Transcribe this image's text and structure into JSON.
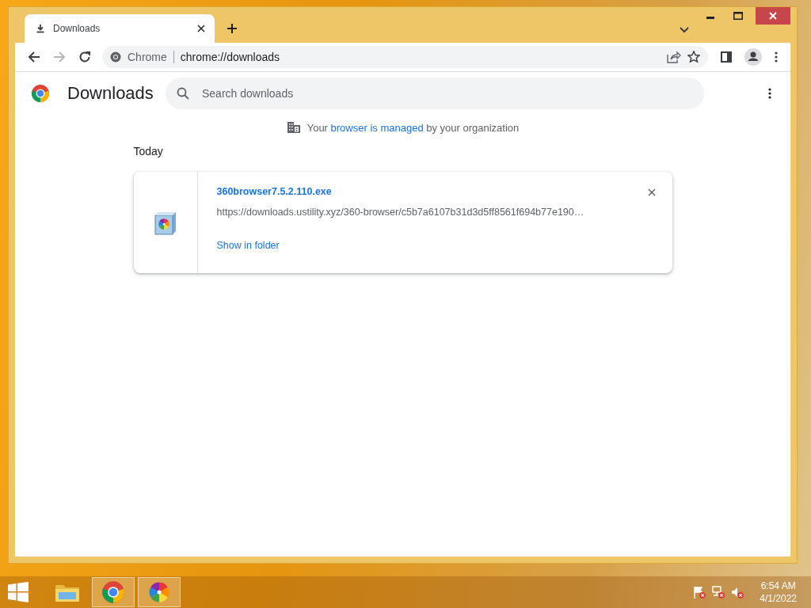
{
  "tabs": [
    {
      "title": "Downloads",
      "selected": true
    }
  ],
  "address_bar": {
    "origin_label": "Chrome",
    "url": "chrome://downloads"
  },
  "page": {
    "title": "Downloads",
    "search": {
      "placeholder": "Search downloads"
    },
    "managed_notice": {
      "before": "Your",
      "link": "browser is managed",
      "after": "by your organization"
    },
    "sections": [
      {
        "heading": "Today",
        "items": [
          {
            "file_name": "360browser7.5.2.110.exe",
            "url": "https://downloads.ustility.xyz/360-browser/c5b7a6107b31d3d5ff8561f694b77e190…",
            "action": "Show in folder"
          }
        ]
      }
    ]
  },
  "taskbar": {
    "apps": [
      {
        "kind": "explorer",
        "selected": false
      },
      {
        "kind": "chrome",
        "selected": true
      },
      {
        "kind": "pinwheel",
        "selected": true
      }
    ],
    "time": "6:54 AM",
    "date": "4/1/2022"
  }
}
